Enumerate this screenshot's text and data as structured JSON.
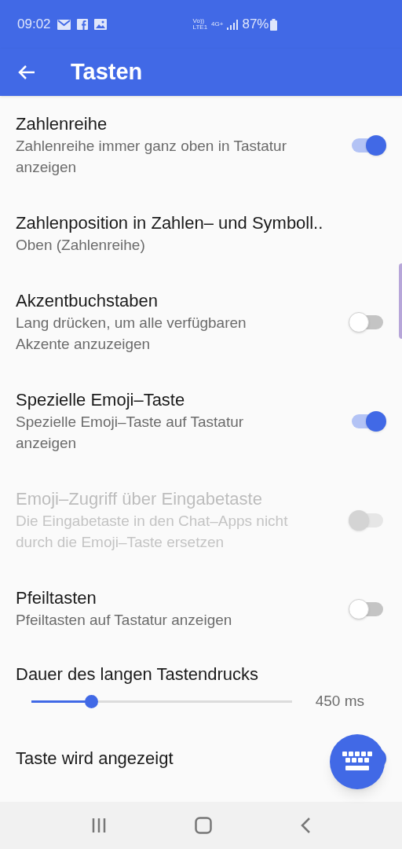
{
  "status_bar": {
    "time": "09:02",
    "network": [
      "Vo))",
      "LTE1",
      "4G+"
    ],
    "battery": "87%"
  },
  "app_bar": {
    "title": "Tasten"
  },
  "settings": [
    {
      "kind": "switch",
      "title": "Zahlenreihe",
      "summary": "Zahlenreihe immer ganz oben in Tastatur anzeigen",
      "on": true,
      "disabled": false
    },
    {
      "kind": "text",
      "title": "Zahlenposition in Zahlen– und Symboll..",
      "summary": "Oben (Zahlenreihe)",
      "disabled": false
    },
    {
      "kind": "switch",
      "title": "Akzentbuchstaben",
      "summary": "Lang drücken, um alle verfügbaren Akzente anzuzeigen",
      "on": false,
      "disabled": false
    },
    {
      "kind": "switch",
      "title": "Spezielle Emoji–Taste",
      "summary": "Spezielle Emoji–Taste auf Tastatur anzeigen",
      "on": true,
      "disabled": false
    },
    {
      "kind": "switch",
      "title": "Emoji–Zugriff über Eingabetaste",
      "summary": "Die Eingabetaste in den Chat–Apps nicht durch die Emoji–Taste ersetzen",
      "on": false,
      "disabled": true
    },
    {
      "kind": "switch",
      "title": "Pfeiltasten",
      "summary": "Pfeiltasten auf Tastatur anzeigen",
      "on": false,
      "disabled": false
    },
    {
      "kind": "slider",
      "title": "Dauer des langen Tastendrucks",
      "level": 0.23,
      "reading": "450 ms",
      "disabled": false
    },
    {
      "kind": "switch",
      "title": "Taste wird angezeigt",
      "on": true,
      "disabled": false
    }
  ]
}
